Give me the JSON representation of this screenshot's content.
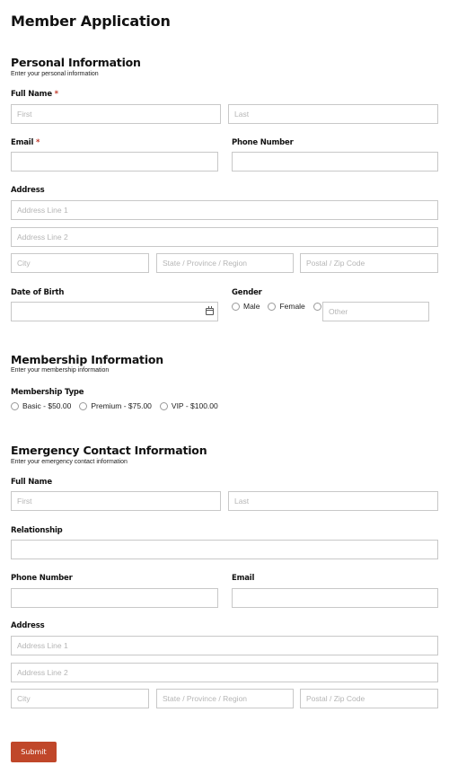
{
  "form": {
    "title": "Member Application",
    "submit_label": "Submit"
  },
  "personal": {
    "title": "Personal Information",
    "subtitle": "Enter your personal information",
    "full_name_label": "Full Name",
    "required_mark": "*",
    "first_placeholder": "First",
    "last_placeholder": "Last",
    "email_label": "Email",
    "phone_label": "Phone Number",
    "address_label": "Address",
    "address1_placeholder": "Address Line 1",
    "address2_placeholder": "Address Line 2",
    "city_placeholder": "City",
    "state_placeholder": "State / Province / Region",
    "zip_placeholder": "Postal / Zip Code",
    "dob_label": "Date of Birth",
    "gender_label": "Gender",
    "gender_options": [
      "Male",
      "Female"
    ],
    "gender_other_placeholder": "Other"
  },
  "membership": {
    "title": "Membership Information",
    "subtitle": "Enter your membership information",
    "type_label": "Membership Type",
    "options": [
      "Basic - $50.00",
      "Premium - $75.00",
      "VIP - $100.00"
    ]
  },
  "emergency": {
    "title": "Emergency Contact Information",
    "subtitle": "Enter your emergency contact information",
    "full_name_label": "Full Name",
    "first_placeholder": "First",
    "last_placeholder": "Last",
    "relationship_label": "Relationship",
    "phone_label": "Phone Number",
    "email_label": "Email",
    "address_label": "Address",
    "address1_placeholder": "Address Line 1",
    "address2_placeholder": "Address Line 2",
    "city_placeholder": "City",
    "state_placeholder": "State / Province / Region",
    "zip_placeholder": "Postal / Zip Code"
  },
  "colors": {
    "accent": "#c0472a",
    "required": "#c0392b",
    "border": "#c8c8c8"
  },
  "icons": {
    "date": "calendar-icon"
  }
}
